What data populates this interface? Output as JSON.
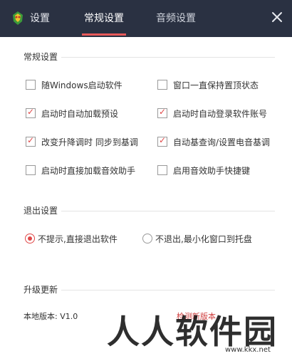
{
  "titlebar": {
    "settings_label": "设置",
    "tabs": [
      {
        "label": "常规设置",
        "active": true
      },
      {
        "label": "音频设置",
        "active": false
      }
    ],
    "close_icon": "close-icon",
    "bg_color": "#2a3142",
    "accent_color": "#e85a5a"
  },
  "general": {
    "title": "常规设置",
    "options": [
      {
        "label": "随Windows启动软件",
        "checked": false
      },
      {
        "label": "窗口一直保持置顶状态",
        "checked": false
      },
      {
        "label": "启动时自动加载预设",
        "checked": true
      },
      {
        "label": "启动时自动登录软件账号",
        "checked": true
      },
      {
        "label": "改变升降调时 同步到基调",
        "checked": true
      },
      {
        "label": "自动基查询/设置电音基调",
        "checked": true
      },
      {
        "label": "启动时直接加载音效助手",
        "checked": false
      },
      {
        "label": "启用音效助手快捷键",
        "checked": false
      }
    ]
  },
  "exit": {
    "title": "退出设置",
    "options": [
      {
        "label": "不提示,直接退出软件",
        "selected": true
      },
      {
        "label": "不退出,最小化窗口到托盘",
        "selected": false
      }
    ]
  },
  "update": {
    "title": "升级更新",
    "version_text": "本地版本: V1.0",
    "partial_link": "检测新版本"
  },
  "watermark": {
    "text": "人人软件园",
    "url": "www.kkx.net"
  }
}
